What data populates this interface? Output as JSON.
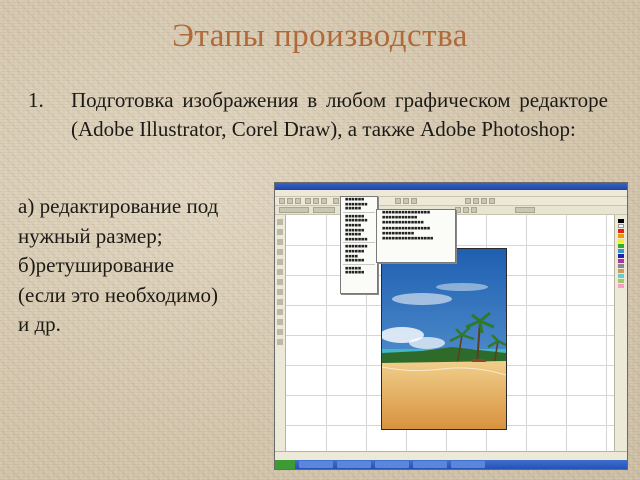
{
  "slide": {
    "title": "Этапы производства",
    "point": {
      "number": "1.",
      "text": "Подготовка изображения в любом графическом редакторе (Adobe Illustrator, Corel Draw), а также Adobe Photoshop:"
    },
    "subpoints": [
      "а) редактирование под",
      "нужный размер;",
      "б)ретуширование",
      "(если это необходимо)",
      "и др."
    ]
  },
  "screenshot": {
    "icon_names": [
      "app-window",
      "photo-icon"
    ],
    "colors": {
      "title_bar": "#1e44a8",
      "sky": "#3a78c8",
      "sand": "#e8b46a",
      "sea": "#3fb8c8",
      "palms": "#2e6a2a"
    }
  },
  "colors": {
    "title": "#b06a3a",
    "text": "#1d1a16",
    "background": "#d9ccb4"
  }
}
